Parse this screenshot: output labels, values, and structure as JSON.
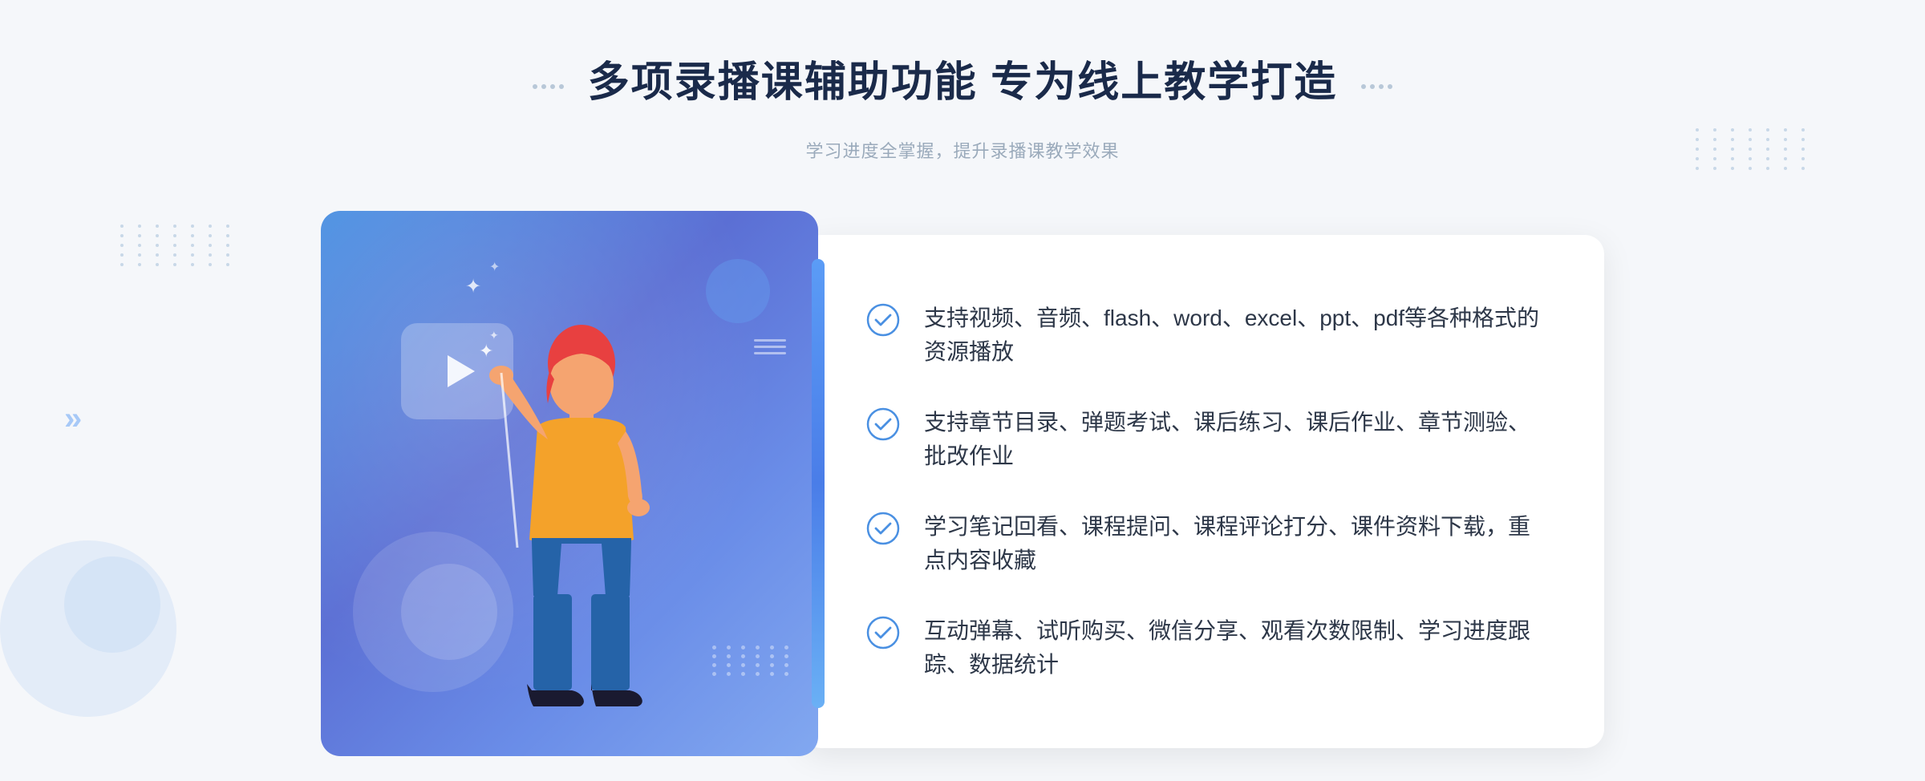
{
  "header": {
    "main_title": "多项录播课辅助功能 专为线上教学打造",
    "sub_title": "学习进度全掌握，提升录播课教学效果"
  },
  "features": [
    {
      "id": 1,
      "text": "支持视频、音频、flash、word、excel、ppt、pdf等各种格式的资源播放"
    },
    {
      "id": 2,
      "text": "支持章节目录、弹题考试、课后练习、课后作业、章节测验、批改作业"
    },
    {
      "id": 3,
      "text": "学习笔记回看、课程提问、课程评论打分、课件资料下载，重点内容收藏"
    },
    {
      "id": 4,
      "text": "互动弹幕、试听购买、微信分享、观看次数限制、学习进度跟踪、数据统计"
    }
  ],
  "icons": {
    "check": "check-circle-icon",
    "play": "play-icon",
    "chevron_left": "«",
    "chevron_right": "»"
  },
  "colors": {
    "primary_blue": "#4a90e2",
    "text_dark": "#2d3748",
    "text_gray": "#9aaabb",
    "title_color": "#1a2a4a",
    "accent_blue": "#5b9cf6"
  }
}
